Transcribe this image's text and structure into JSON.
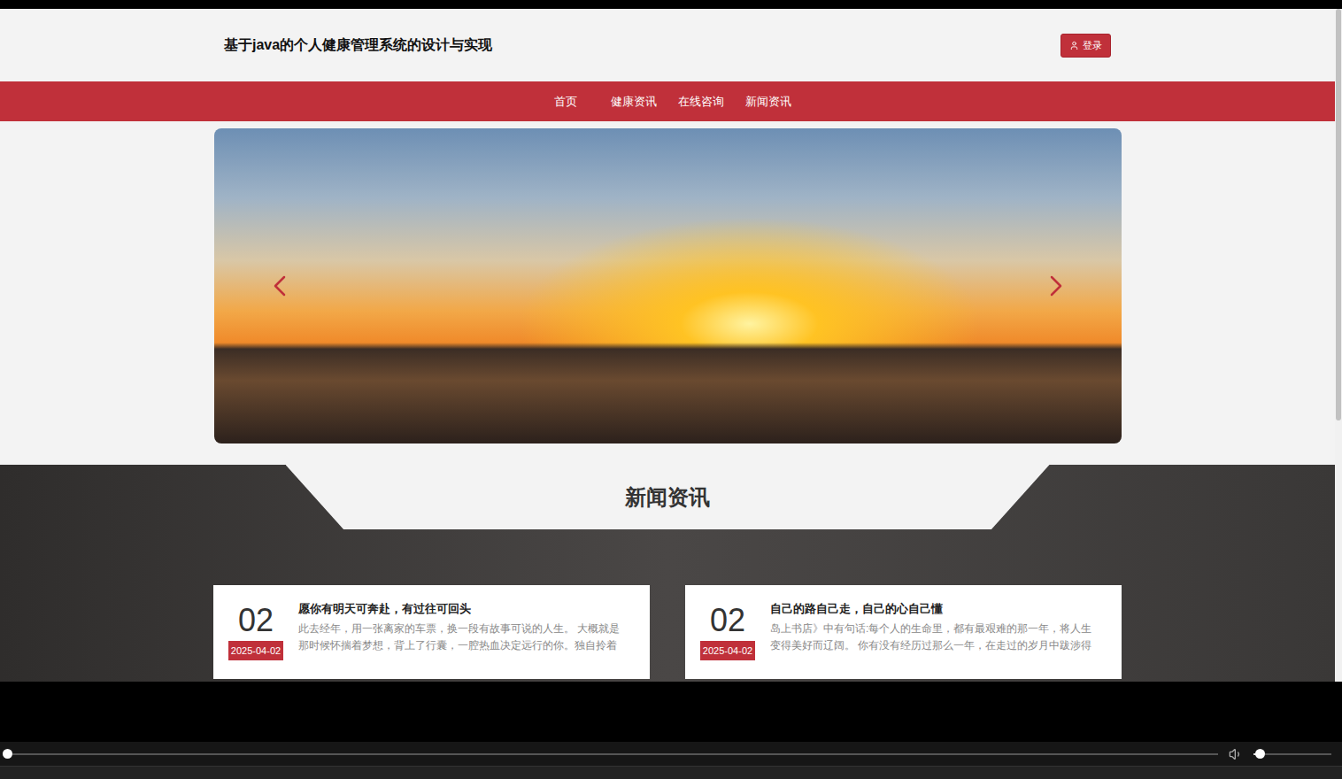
{
  "header": {
    "title": "基于java的个人健康管理系统的设计与实现",
    "login_button": "登录"
  },
  "nav": {
    "items": [
      "首页",
      "健康资讯",
      "在线咨询",
      "新闻资讯"
    ]
  },
  "news": {
    "title": "新闻资讯",
    "cards": [
      {
        "day": "02",
        "date": "2025-04-02",
        "title": "愿你有明天可奔赴，有过往可回头",
        "excerpt": [
          "此去经年，用一张离家的车票，换一段有故事可说的人生。 大概就是",
          "那时候怀揣着梦想，背上了行囊，一腔热血决定远行的你。独自拎着"
        ]
      },
      {
        "day": "02",
        "date": "2025-04-02",
        "title": "自己的路自己走，自己的心自己懂",
        "excerpt": [
          "岛上书店》中有句话:每个人的生命里，都有最艰难的那一年，将人生",
          "变得美好而辽阔。 你有没有经历过那么一年，在走过的岁月中跋涉得"
        ]
      }
    ]
  },
  "player": {
    "progress": {
      "level": 0.0
    },
    "volume": {
      "level": 0.08
    }
  }
}
